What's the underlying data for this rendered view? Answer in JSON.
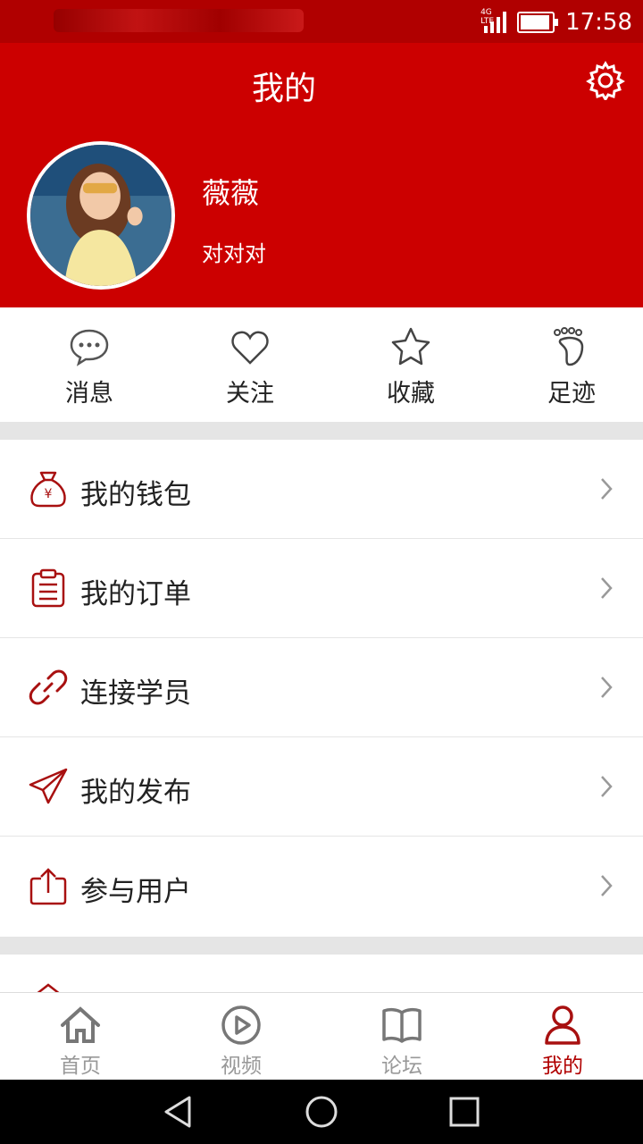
{
  "status_bar": {
    "time": "17:58",
    "network": "4G LTE",
    "battery_level": 0.9
  },
  "header": {
    "title": "我的",
    "settings_icon": "gear-icon"
  },
  "profile": {
    "name": "薇薇",
    "signature": "对对对",
    "avatar": "avatar-photo"
  },
  "quick_actions": [
    {
      "label": "消息",
      "icon": "chat-bubble-icon"
    },
    {
      "label": "关注",
      "icon": "heart-icon"
    },
    {
      "label": "收藏",
      "icon": "star-icon"
    },
    {
      "label": "足迹",
      "icon": "footprint-icon"
    }
  ],
  "menu": [
    {
      "label": "我的钱包",
      "icon": "money-bag-icon"
    },
    {
      "label": "我的订单",
      "icon": "clipboard-icon"
    },
    {
      "label": "连接学员",
      "icon": "link-icon"
    },
    {
      "label": "我的发布",
      "icon": "paper-plane-icon"
    },
    {
      "label": "参与用户",
      "icon": "upload-icon"
    }
  ],
  "tabs": [
    {
      "label": "首页",
      "icon": "home-icon",
      "active": false
    },
    {
      "label": "视频",
      "icon": "play-icon",
      "active": false
    },
    {
      "label": "论坛",
      "icon": "book-icon",
      "active": false
    },
    {
      "label": "我的",
      "icon": "user-icon",
      "active": true
    }
  ],
  "colors": {
    "primary": "#cc0000",
    "icon_red": "#a81010",
    "tab_inactive": "#999999"
  }
}
